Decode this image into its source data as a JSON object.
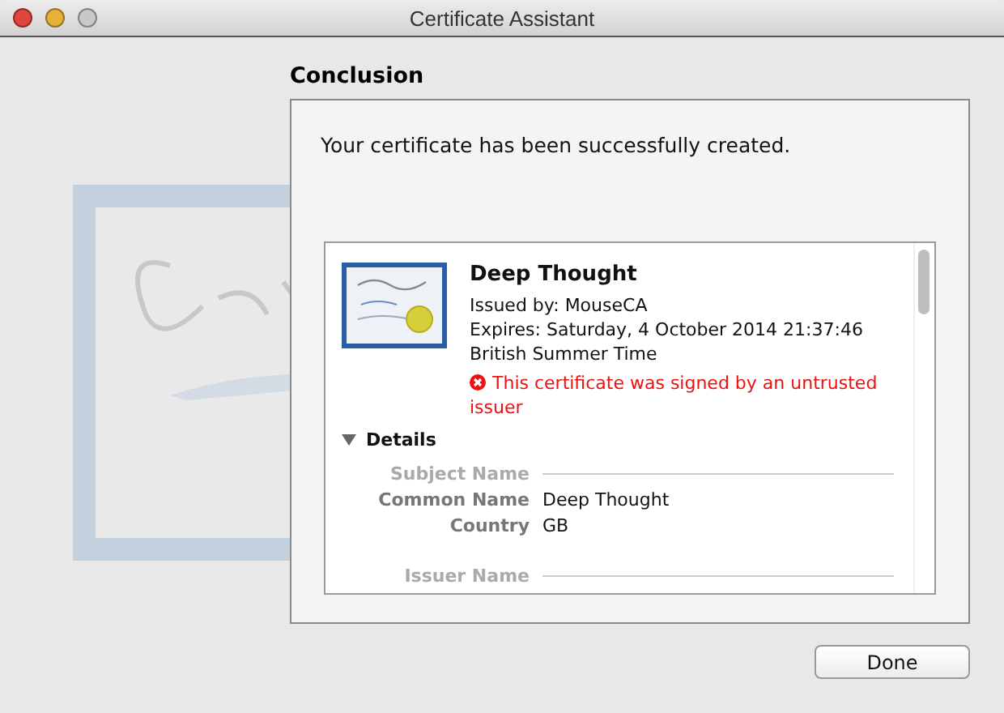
{
  "window": {
    "title": "Certificate Assistant"
  },
  "heading": "Conclusion",
  "message": "Your certificate has been successfully created.",
  "certificate": {
    "name": "Deep Thought",
    "issued_by": "Issued by: MouseCA",
    "expires": "Expires: Saturday, 4 October 2014 21:37:46 British Summer Time",
    "warning": "This certificate was signed by an untrusted issuer"
  },
  "details": {
    "label": "Details",
    "expanded": true,
    "sections": [
      {
        "heading": "Subject Name",
        "rows": [
          {
            "label": "Common Name",
            "value": "Deep Thought"
          },
          {
            "label": "Country",
            "value": "GB"
          }
        ]
      },
      {
        "heading": "Issuer Name"
      }
    ]
  },
  "buttons": [
    "Done"
  ]
}
